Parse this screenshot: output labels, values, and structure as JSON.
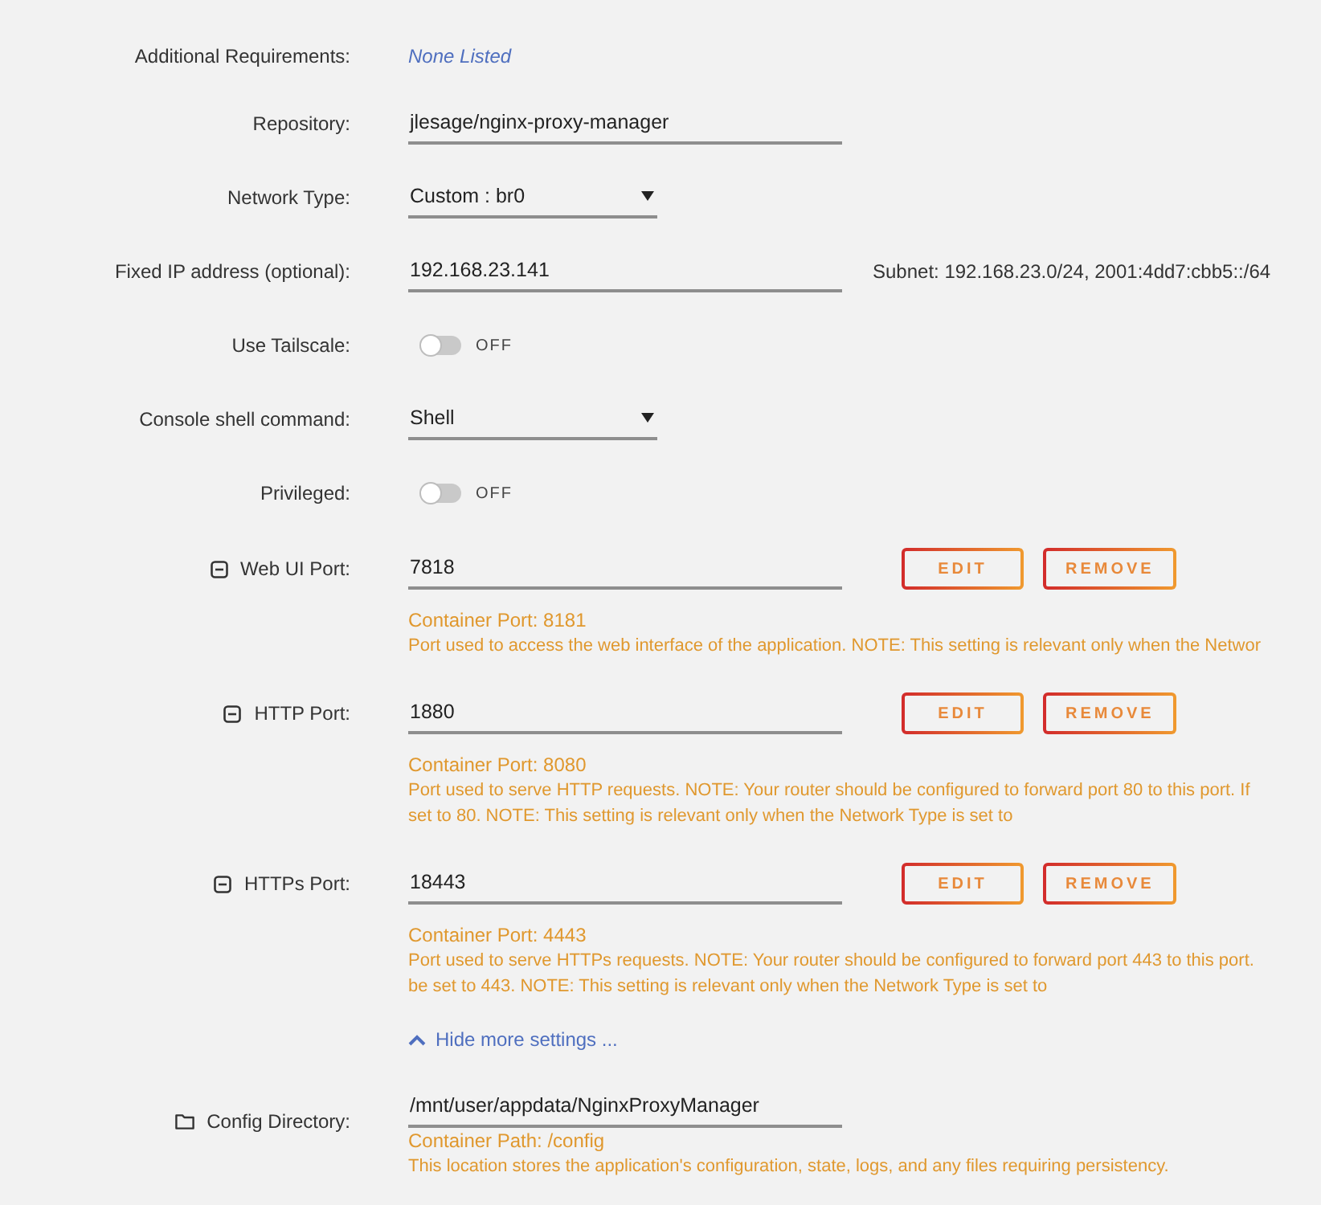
{
  "settings": [
    {
      "kind": "link-text",
      "label": "Additional Requirements:",
      "value": "None Listed"
    },
    {
      "kind": "text-field",
      "label": "Repository:",
      "value": "jlesage/nginx-proxy-manager"
    },
    {
      "kind": "dropdown",
      "label": "Network Type:",
      "value": "Custom : br0"
    },
    {
      "kind": "text-field",
      "label": "Fixed IP address (optional):",
      "value": "192.168.23.141",
      "note": "Subnet: 192.168.23.0/24, 2001:4dd7:cbb5::/64"
    },
    {
      "kind": "toggle",
      "label": "Use Tailscale:",
      "on": false,
      "state_text": "OFF"
    },
    {
      "kind": "dropdown",
      "label": "Console shell command:",
      "value": "Shell"
    },
    {
      "kind": "toggle",
      "label": "Privileged:",
      "on": false,
      "state_text": "OFF"
    },
    {
      "kind": "port",
      "label": "Web UI Port:",
      "value": "7818",
      "buttons": [
        "EDIT",
        "REMOVE"
      ],
      "container": "Container Port: 8181",
      "description": [
        "Port used to access the web interface of the application. NOTE: This setting is relevant only when the Networ"
      ]
    },
    {
      "kind": "port",
      "label": "HTTP Port:",
      "value": "1880",
      "buttons": [
        "EDIT",
        "REMOVE"
      ],
      "container": "Container Port: 8080",
      "description": [
        "Port used to serve HTTP requests. NOTE: Your router should be configured to forward port 80 to this port. If",
        "set to 80. NOTE: This setting is relevant only when the Network Type is set to"
      ]
    },
    {
      "kind": "port",
      "label": "HTTPs Port:",
      "value": "18443",
      "buttons": [
        "EDIT",
        "REMOVE"
      ],
      "container": "Container Port: 4443",
      "description": [
        "Port used to serve HTTPs requests. NOTE: Your router should be configured to forward port 443 to this port.",
        "be set to 443. NOTE: This setting is relevant only when the Network Type is set to"
      ]
    },
    {
      "kind": "more-link",
      "text": "Hide more settings ...",
      "expanded": true
    },
    {
      "kind": "path",
      "label": "Config Directory:",
      "value": "/mnt/user/appdata/NginxProxyManager",
      "container": "Container Path: /config",
      "description": [
        "This location stores the application's configuration, state, logs, and any files requiring persistency."
      ]
    }
  ]
}
